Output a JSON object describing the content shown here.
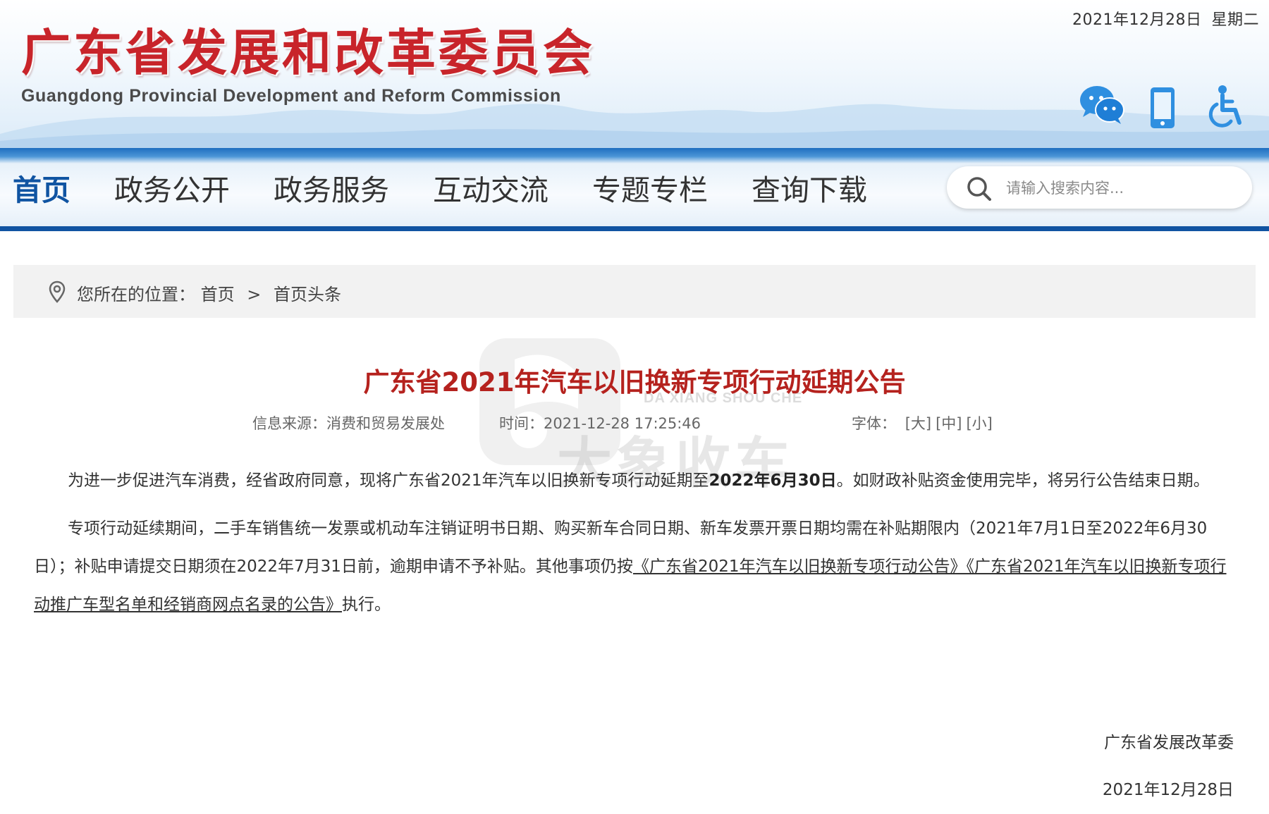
{
  "header": {
    "date": "2021年12月28日",
    "weekday": "星期二",
    "site_name_cn": "广东省发展和改革委员会",
    "site_name_en": "Guangdong Provincial Development and Reform Commission",
    "icons": [
      "wechat-icon",
      "mobile-icon",
      "accessibility-icon"
    ]
  },
  "nav": {
    "items": [
      {
        "label": "首页",
        "active": true
      },
      {
        "label": "政务公开",
        "active": false
      },
      {
        "label": "政务服务",
        "active": false
      },
      {
        "label": "互动交流",
        "active": false
      },
      {
        "label": "专题专栏",
        "active": false
      },
      {
        "label": "查询下载",
        "active": false
      }
    ],
    "search_placeholder": "请输入搜索内容..."
  },
  "breadcrumb": {
    "label": "您所在的位置：",
    "items": [
      "首页",
      "首页头条"
    ],
    "separator": ">"
  },
  "watermark": {
    "text_cn": "大象收车",
    "text_en": "DA XIANG SHOU CHE"
  },
  "article": {
    "title": "广东省2021年汽车以旧换新专项行动延期公告",
    "source_label": "信息来源：",
    "source": "消费和贸易发展处",
    "time_label": "时间：",
    "time": "2021-12-28 17:25:46",
    "font_label": "字体：",
    "font_sizes": [
      "[大]",
      "[中]",
      "[小]"
    ],
    "p1_a": "为进一步促进汽车消费，经省政府同意，现将广东省2021年汽车以旧换新专项行动延期至",
    "p1_bold": "2022年6月30日",
    "p1_b": "。如财政补贴资金使用完毕，将另行公告结束日期。",
    "p2_a": "专项行动延续期间，二手车销售统一发票或机动车注销证明书日期、购买新车合同日期、新车发票开票日期均需在补贴期限内（2021年7月1日至2022年6月30日）；补贴申请提交日期须在2022年7月31日前，逾期申请不予补贴。其他事项仍按",
    "p2_link": "《广东省2021年汽车以旧换新专项行动公告》《广东省2021年汽车以旧换新专项行动推广车型名单和经销商网点名录的公告》",
    "p2_b": "执行。",
    "signature": "广东省发展改革委",
    "sign_date": "2021年12月28日"
  },
  "colors": {
    "brand_red": "#c8242a",
    "title_red": "#b5221e",
    "nav_blue": "#1054a2",
    "icon_blue": "#2f8fe0"
  }
}
